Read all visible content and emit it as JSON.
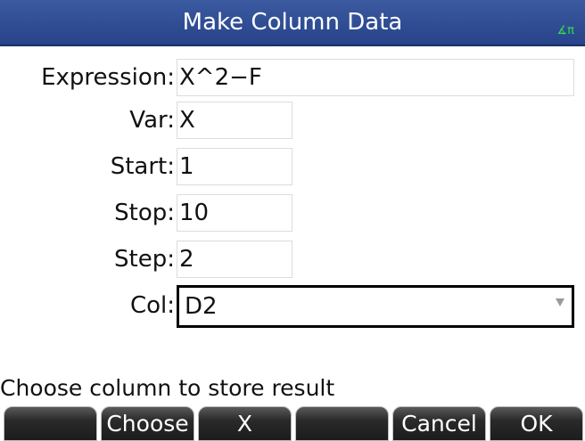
{
  "title_bar": {
    "title": "Make Column Data",
    "angle_mode": "∡π"
  },
  "form": {
    "expression": {
      "label": "Expression:",
      "value": "X^2−F"
    },
    "var": {
      "label": "Var:",
      "value": "X"
    },
    "start": {
      "label": "Start:",
      "value": "1"
    },
    "stop": {
      "label": "Stop:",
      "value": "10"
    },
    "step": {
      "label": "Step:",
      "value": "2"
    },
    "col": {
      "label": "Col:",
      "value": "D2"
    }
  },
  "help_text": "Choose column to store result",
  "softkeys": {
    "key1": "",
    "key2": "Choose",
    "key3": "X",
    "key4": "",
    "key5": "Cancel",
    "key6": "OK"
  },
  "colors": {
    "title_bar": "#2f4d95",
    "angle_indicator": "#2ee04a",
    "softkey_bg": "#1c1c1c"
  },
  "icons": {
    "dropdown": "chevron-down-icon"
  }
}
